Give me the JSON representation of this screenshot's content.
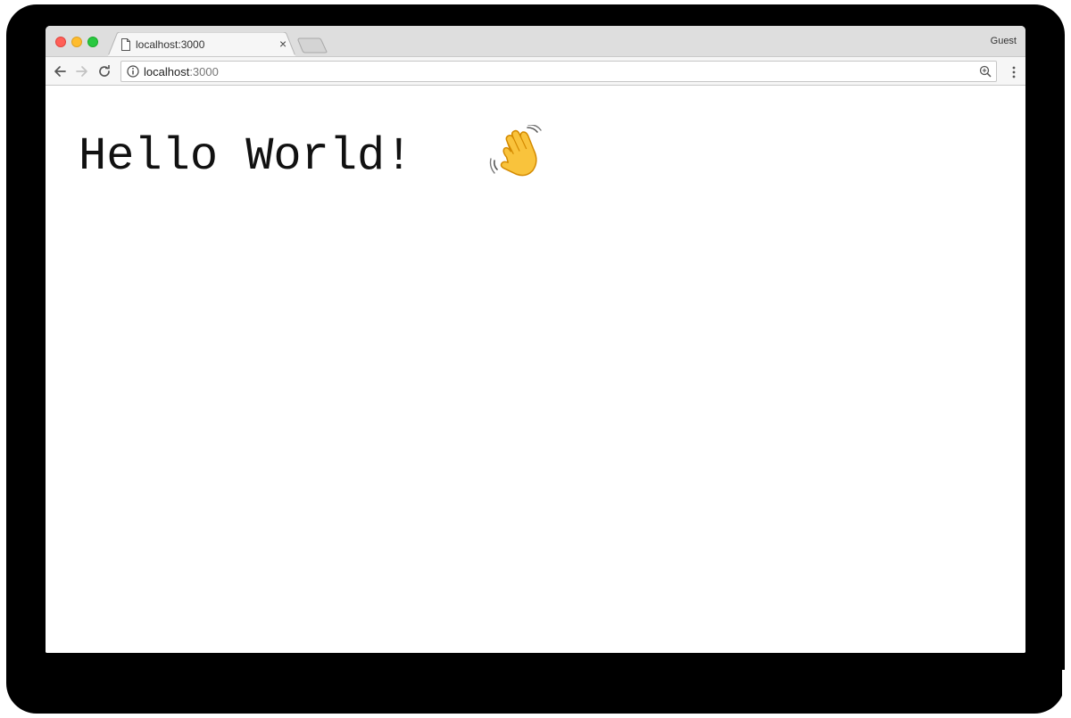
{
  "window": {
    "colors": {
      "close": "#ff5f57",
      "minimize": "#febc2e",
      "maximize": "#28c840"
    }
  },
  "tabs": [
    {
      "title": "localhost:3000",
      "icon": "page-icon",
      "active": true
    }
  ],
  "profile": {
    "label": "Guest"
  },
  "toolbar": {
    "url_host": "localhost",
    "url_port": ":3000",
    "icons": [
      "back-arrow-icon",
      "forward-arrow-icon",
      "reload-icon",
      "info-icon",
      "zoom-icon",
      "menu-dots-icon"
    ]
  },
  "page": {
    "heading": "Hello World!",
    "emoji": "waving-hand-icon"
  }
}
